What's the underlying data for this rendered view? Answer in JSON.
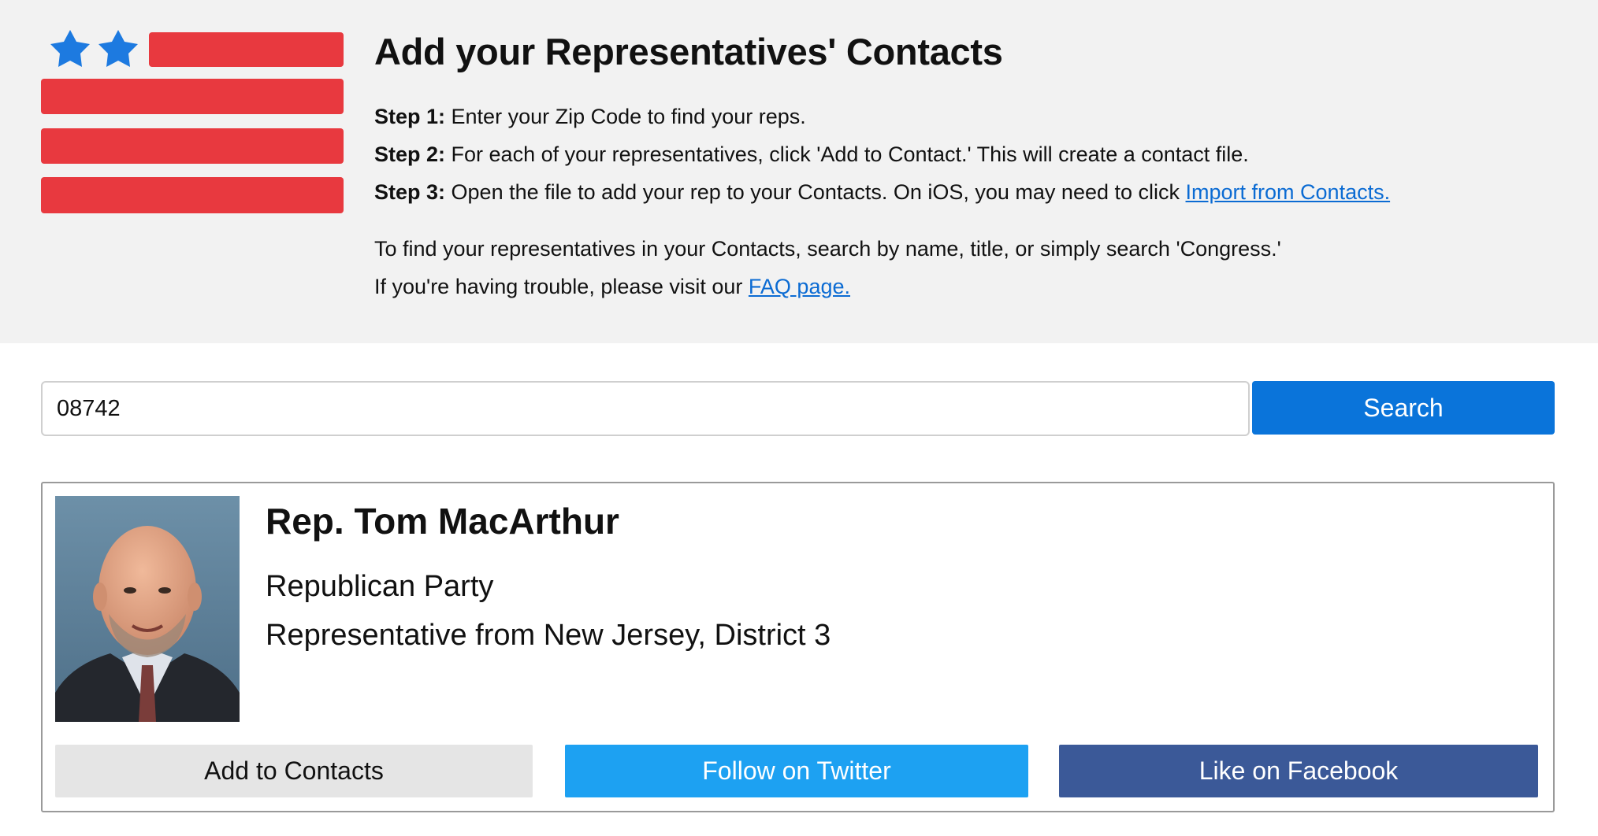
{
  "colors": {
    "header_bg": "#f2f2f2",
    "flag_red": "#e8393f",
    "flag_star_blue": "#1d7ae0",
    "link": "#0b6bd3",
    "search_button": "#0a74da",
    "twitter": "#1da1f2",
    "facebook": "#3b5998"
  },
  "header": {
    "title": "Add your Representatives' Contacts",
    "steps": [
      {
        "label": "Step 1:",
        "text": " Enter your Zip Code to find your reps."
      },
      {
        "label": "Step 2:",
        "text": " For each of your representatives, click 'Add to Contact.' This will create a contact file."
      },
      {
        "label": "Step 3:",
        "text": " Open the file to add your rep to your Contacts. On iOS, you may need to click ",
        "link": "Import from Contacts."
      }
    ],
    "note1": "To find your representatives in your Contacts, search by name, title, or simply search 'Congress.'",
    "note2_text": "If you're having trouble, please visit our ",
    "note2_link": "FAQ page."
  },
  "search": {
    "value": "08742",
    "button_label": "Search"
  },
  "rep": {
    "name": "Rep. Tom MacArthur",
    "party": "Republican Party",
    "district": "Representative from New Jersey, District 3",
    "buttons": {
      "add_contacts": "Add to Contacts",
      "twitter": "Follow on Twitter",
      "facebook": "Like on Facebook"
    }
  }
}
